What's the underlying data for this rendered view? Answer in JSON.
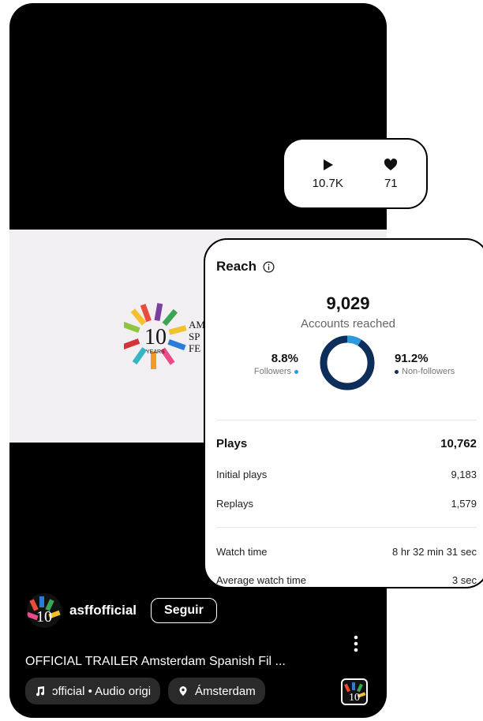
{
  "reel": {
    "author": "asffofficial",
    "follow_label": "Seguir",
    "caption": "OFFICIAL TRAILER Amsterdam Spanish Fil ...",
    "audio_chip": "ɔfficial • Audio origi",
    "location_chip": "Ámsterdam"
  },
  "stats": {
    "plays": "10.7K",
    "likes": "71"
  },
  "reach": {
    "title": "Reach",
    "accounts_reached_value": "9,029",
    "accounts_reached_label": "Accounts reached",
    "followers_pct": "8.8%",
    "followers_label": "Followers",
    "non_followers_pct": "91.2%",
    "non_followers_label": "Non-followers",
    "followers_fraction": 0.088,
    "colors": {
      "followers": "#2b9be0",
      "non_followers": "#0d2d5a"
    }
  },
  "metrics": {
    "plays_label": "Plays",
    "plays_value": "10,762",
    "initial_label": "Initial plays",
    "initial_value": "9,183",
    "replays_label": "Replays",
    "replays_value": "1,579",
    "watch_label": "Watch time",
    "watch_value": "8 hr 32 min 31 sec",
    "avg_label": "Average watch time",
    "avg_value": "3 sec"
  }
}
